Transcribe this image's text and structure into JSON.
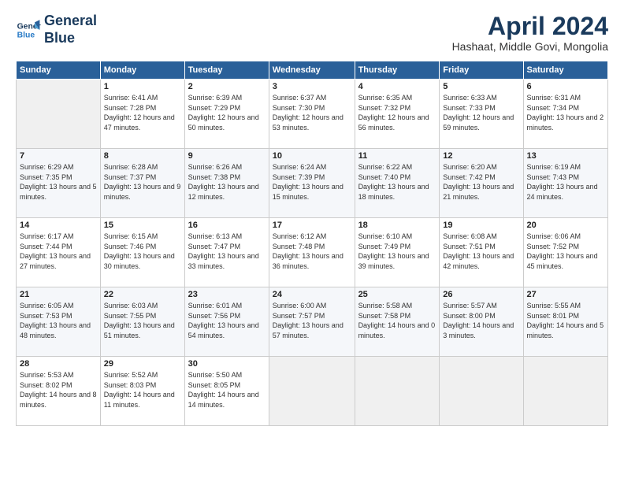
{
  "header": {
    "logo_line1": "General",
    "logo_line2": "Blue",
    "month_title": "April 2024",
    "subtitle": "Hashaat, Middle Govi, Mongolia"
  },
  "days_of_week": [
    "Sunday",
    "Monday",
    "Tuesday",
    "Wednesday",
    "Thursday",
    "Friday",
    "Saturday"
  ],
  "weeks": [
    [
      {
        "num": "",
        "sunrise": "",
        "sunset": "",
        "daylight": ""
      },
      {
        "num": "1",
        "sunrise": "Sunrise: 6:41 AM",
        "sunset": "Sunset: 7:28 PM",
        "daylight": "Daylight: 12 hours and 47 minutes."
      },
      {
        "num": "2",
        "sunrise": "Sunrise: 6:39 AM",
        "sunset": "Sunset: 7:29 PM",
        "daylight": "Daylight: 12 hours and 50 minutes."
      },
      {
        "num": "3",
        "sunrise": "Sunrise: 6:37 AM",
        "sunset": "Sunset: 7:30 PM",
        "daylight": "Daylight: 12 hours and 53 minutes."
      },
      {
        "num": "4",
        "sunrise": "Sunrise: 6:35 AM",
        "sunset": "Sunset: 7:32 PM",
        "daylight": "Daylight: 12 hours and 56 minutes."
      },
      {
        "num": "5",
        "sunrise": "Sunrise: 6:33 AM",
        "sunset": "Sunset: 7:33 PM",
        "daylight": "Daylight: 12 hours and 59 minutes."
      },
      {
        "num": "6",
        "sunrise": "Sunrise: 6:31 AM",
        "sunset": "Sunset: 7:34 PM",
        "daylight": "Daylight: 13 hours and 2 minutes."
      }
    ],
    [
      {
        "num": "7",
        "sunrise": "Sunrise: 6:29 AM",
        "sunset": "Sunset: 7:35 PM",
        "daylight": "Daylight: 13 hours and 5 minutes."
      },
      {
        "num": "8",
        "sunrise": "Sunrise: 6:28 AM",
        "sunset": "Sunset: 7:37 PM",
        "daylight": "Daylight: 13 hours and 9 minutes."
      },
      {
        "num": "9",
        "sunrise": "Sunrise: 6:26 AM",
        "sunset": "Sunset: 7:38 PM",
        "daylight": "Daylight: 13 hours and 12 minutes."
      },
      {
        "num": "10",
        "sunrise": "Sunrise: 6:24 AM",
        "sunset": "Sunset: 7:39 PM",
        "daylight": "Daylight: 13 hours and 15 minutes."
      },
      {
        "num": "11",
        "sunrise": "Sunrise: 6:22 AM",
        "sunset": "Sunset: 7:40 PM",
        "daylight": "Daylight: 13 hours and 18 minutes."
      },
      {
        "num": "12",
        "sunrise": "Sunrise: 6:20 AM",
        "sunset": "Sunset: 7:42 PM",
        "daylight": "Daylight: 13 hours and 21 minutes."
      },
      {
        "num": "13",
        "sunrise": "Sunrise: 6:19 AM",
        "sunset": "Sunset: 7:43 PM",
        "daylight": "Daylight: 13 hours and 24 minutes."
      }
    ],
    [
      {
        "num": "14",
        "sunrise": "Sunrise: 6:17 AM",
        "sunset": "Sunset: 7:44 PM",
        "daylight": "Daylight: 13 hours and 27 minutes."
      },
      {
        "num": "15",
        "sunrise": "Sunrise: 6:15 AM",
        "sunset": "Sunset: 7:46 PM",
        "daylight": "Daylight: 13 hours and 30 minutes."
      },
      {
        "num": "16",
        "sunrise": "Sunrise: 6:13 AM",
        "sunset": "Sunset: 7:47 PM",
        "daylight": "Daylight: 13 hours and 33 minutes."
      },
      {
        "num": "17",
        "sunrise": "Sunrise: 6:12 AM",
        "sunset": "Sunset: 7:48 PM",
        "daylight": "Daylight: 13 hours and 36 minutes."
      },
      {
        "num": "18",
        "sunrise": "Sunrise: 6:10 AM",
        "sunset": "Sunset: 7:49 PM",
        "daylight": "Daylight: 13 hours and 39 minutes."
      },
      {
        "num": "19",
        "sunrise": "Sunrise: 6:08 AM",
        "sunset": "Sunset: 7:51 PM",
        "daylight": "Daylight: 13 hours and 42 minutes."
      },
      {
        "num": "20",
        "sunrise": "Sunrise: 6:06 AM",
        "sunset": "Sunset: 7:52 PM",
        "daylight": "Daylight: 13 hours and 45 minutes."
      }
    ],
    [
      {
        "num": "21",
        "sunrise": "Sunrise: 6:05 AM",
        "sunset": "Sunset: 7:53 PM",
        "daylight": "Daylight: 13 hours and 48 minutes."
      },
      {
        "num": "22",
        "sunrise": "Sunrise: 6:03 AM",
        "sunset": "Sunset: 7:55 PM",
        "daylight": "Daylight: 13 hours and 51 minutes."
      },
      {
        "num": "23",
        "sunrise": "Sunrise: 6:01 AM",
        "sunset": "Sunset: 7:56 PM",
        "daylight": "Daylight: 13 hours and 54 minutes."
      },
      {
        "num": "24",
        "sunrise": "Sunrise: 6:00 AM",
        "sunset": "Sunset: 7:57 PM",
        "daylight": "Daylight: 13 hours and 57 minutes."
      },
      {
        "num": "25",
        "sunrise": "Sunrise: 5:58 AM",
        "sunset": "Sunset: 7:58 PM",
        "daylight": "Daylight: 14 hours and 0 minutes."
      },
      {
        "num": "26",
        "sunrise": "Sunrise: 5:57 AM",
        "sunset": "Sunset: 8:00 PM",
        "daylight": "Daylight: 14 hours and 3 minutes."
      },
      {
        "num": "27",
        "sunrise": "Sunrise: 5:55 AM",
        "sunset": "Sunset: 8:01 PM",
        "daylight": "Daylight: 14 hours and 5 minutes."
      }
    ],
    [
      {
        "num": "28",
        "sunrise": "Sunrise: 5:53 AM",
        "sunset": "Sunset: 8:02 PM",
        "daylight": "Daylight: 14 hours and 8 minutes."
      },
      {
        "num": "29",
        "sunrise": "Sunrise: 5:52 AM",
        "sunset": "Sunset: 8:03 PM",
        "daylight": "Daylight: 14 hours and 11 minutes."
      },
      {
        "num": "30",
        "sunrise": "Sunrise: 5:50 AM",
        "sunset": "Sunset: 8:05 PM",
        "daylight": "Daylight: 14 hours and 14 minutes."
      },
      {
        "num": "",
        "sunrise": "",
        "sunset": "",
        "daylight": ""
      },
      {
        "num": "",
        "sunrise": "",
        "sunset": "",
        "daylight": ""
      },
      {
        "num": "",
        "sunrise": "",
        "sunset": "",
        "daylight": ""
      },
      {
        "num": "",
        "sunrise": "",
        "sunset": "",
        "daylight": ""
      }
    ]
  ]
}
